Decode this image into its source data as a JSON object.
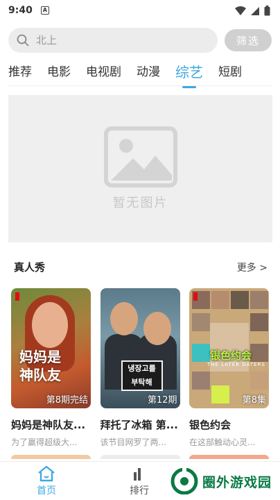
{
  "status_bar": {
    "time": "9:40",
    "app_badge": "A"
  },
  "search": {
    "placeholder": "北上",
    "filter_label": "筛选"
  },
  "tabs": [
    {
      "label": "推荐"
    },
    {
      "label": "电影"
    },
    {
      "label": "电视剧"
    },
    {
      "label": "动漫"
    },
    {
      "label": "综艺",
      "active": true
    },
    {
      "label": "短剧"
    }
  ],
  "banner": {
    "placeholder_text": "暂无图片"
  },
  "section": {
    "title": "真人秀",
    "more": "更多 >"
  },
  "cards": [
    {
      "title": "妈妈是神队友...",
      "desc": "为了赢得超级大...",
      "episode": "第8期完结",
      "poster_text": "妈妈是\n神队友"
    },
    {
      "title": "拜托了冰箱 第...",
      "desc": "该节目网罗了两...",
      "episode": "第12期",
      "poster_text": "냉장고를\n부탁해"
    },
    {
      "title": "银色约会",
      "desc": "在这部触动心灵...",
      "episode": "第8集",
      "poster_text": "银色约会",
      "poster_sub": "THE LATER DATERS"
    }
  ],
  "nav": [
    {
      "label": "首页",
      "icon": "home-icon",
      "active": true
    },
    {
      "label": "排行",
      "icon": "ranking-icon"
    }
  ],
  "watermark": {
    "text": "圈外游戏园"
  },
  "colors": {
    "accent": "#3fa9e0",
    "placeholder_bg": "#efefef",
    "watermark": "#0a7a44"
  }
}
